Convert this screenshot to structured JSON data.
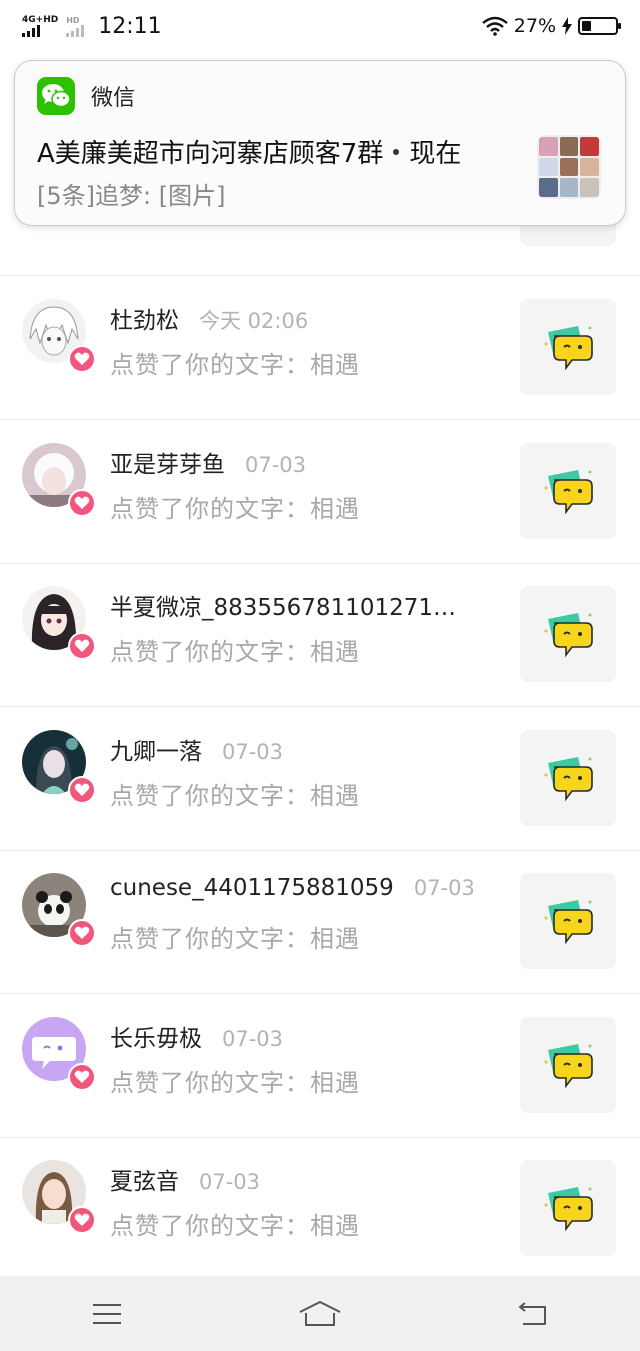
{
  "status_bar": {
    "network": "4G+HD",
    "network2": "HD",
    "time": "12:11",
    "battery_percent": "27%",
    "battery_level": 0.27
  },
  "notification": {
    "app_name": "微信",
    "title": "A美廉美超市向河寨店顾客7群",
    "when": "现在",
    "body": "[5条]追梦: [图片]"
  },
  "likes": [
    {
      "name": "杜劲松",
      "time": "今天 02:06",
      "action": "点赞了你的文字：相遇",
      "avatar": "sketch-girl-avatar"
    },
    {
      "name": "亚是芽芽鱼",
      "time": "07-03",
      "action": "点赞了你的文字：相遇",
      "avatar": "white-hair-avatar"
    },
    {
      "name": "半夏微凉_883556781101271…",
      "time": "",
      "action": "点赞了你的文字：相遇",
      "avatar": "anime-girl-avatar"
    },
    {
      "name": "九卿一落",
      "time": "07-03",
      "action": "点赞了你的文字：相遇",
      "avatar": "fantasy-girl-avatar"
    },
    {
      "name": "cunese_4401175881059",
      "time": "07-03",
      "action": "点赞了你的文字：相遇",
      "avatar": "panda-avatar"
    },
    {
      "name": "长乐毋极",
      "time": "07-03",
      "action": "点赞了你的文字：相遇",
      "avatar": "chat-bubble-avatar"
    },
    {
      "name": "夏弦音",
      "time": "07-03",
      "action": "点赞了你的文字：相遇",
      "avatar": "photo-girl-avatar"
    }
  ],
  "colors": {
    "heart_badge": "#f3567b",
    "wechat_green": "#2dc100",
    "speech_yellow": "#f7d51d",
    "speech_teal": "#3cc9a4"
  },
  "nav": {
    "menu_icon": "menu-icon",
    "home_icon": "home-icon",
    "back_icon": "back-icon"
  }
}
